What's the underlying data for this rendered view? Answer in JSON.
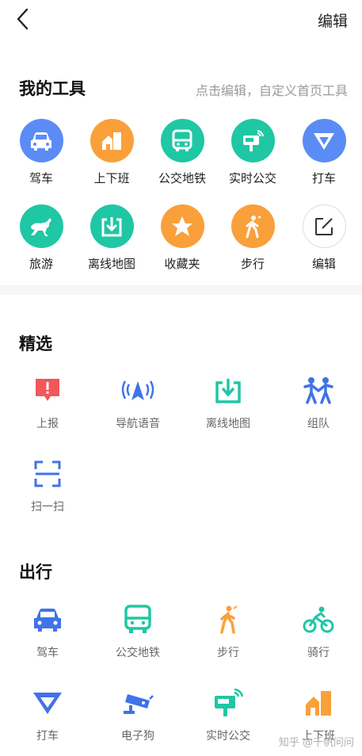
{
  "header": {
    "edit_label": "编辑"
  },
  "my_tools": {
    "title": "我的工具",
    "hint": "点击编辑，自定义首页工具",
    "items": [
      {
        "label": "驾车",
        "icon": "car-icon",
        "color": "#5b8cf5"
      },
      {
        "label": "上下班",
        "icon": "home-office-icon",
        "color": "#f9a03a"
      },
      {
        "label": "公交地铁",
        "icon": "bus-icon",
        "color": "#1fc7a4"
      },
      {
        "label": "实时公交",
        "icon": "bus-stop-icon",
        "color": "#1fc7a4"
      },
      {
        "label": "打车",
        "icon": "taxi-icon",
        "color": "#5b8cf5"
      },
      {
        "label": "旅游",
        "icon": "horse-icon",
        "color": "#1fc7a4"
      },
      {
        "label": "离线地图",
        "icon": "download-icon",
        "color": "#1fc7a4"
      },
      {
        "label": "收藏夹",
        "icon": "star-icon",
        "color": "#f9a03a"
      },
      {
        "label": "步行",
        "icon": "walk-icon",
        "color": "#f9a03a"
      },
      {
        "label": "编辑",
        "icon": "edit-icon",
        "color": "#ffffff"
      }
    ]
  },
  "featured": {
    "title": "精选",
    "items": [
      {
        "label": "上报",
        "icon": "report-icon"
      },
      {
        "label": "导航语音",
        "icon": "navigation-voice-icon"
      },
      {
        "label": "离线地图",
        "icon": "download-icon"
      },
      {
        "label": "组队",
        "icon": "team-icon"
      },
      {
        "label": "扫一扫",
        "icon": "scan-icon"
      }
    ]
  },
  "travel": {
    "title": "出行",
    "items": [
      {
        "label": "驾车",
        "icon": "car-icon"
      },
      {
        "label": "公交地铁",
        "icon": "bus-icon"
      },
      {
        "label": "步行",
        "icon": "walk-icon"
      },
      {
        "label": "骑行",
        "icon": "bike-icon"
      },
      {
        "label": "打车",
        "icon": "taxi-icon"
      },
      {
        "label": "电子狗",
        "icon": "camera-icon"
      },
      {
        "label": "实时公交",
        "icon": "bus-stop-icon"
      },
      {
        "label": "上下班",
        "icon": "home-office-icon"
      }
    ]
  },
  "watermark": "知乎 @千帆问问"
}
